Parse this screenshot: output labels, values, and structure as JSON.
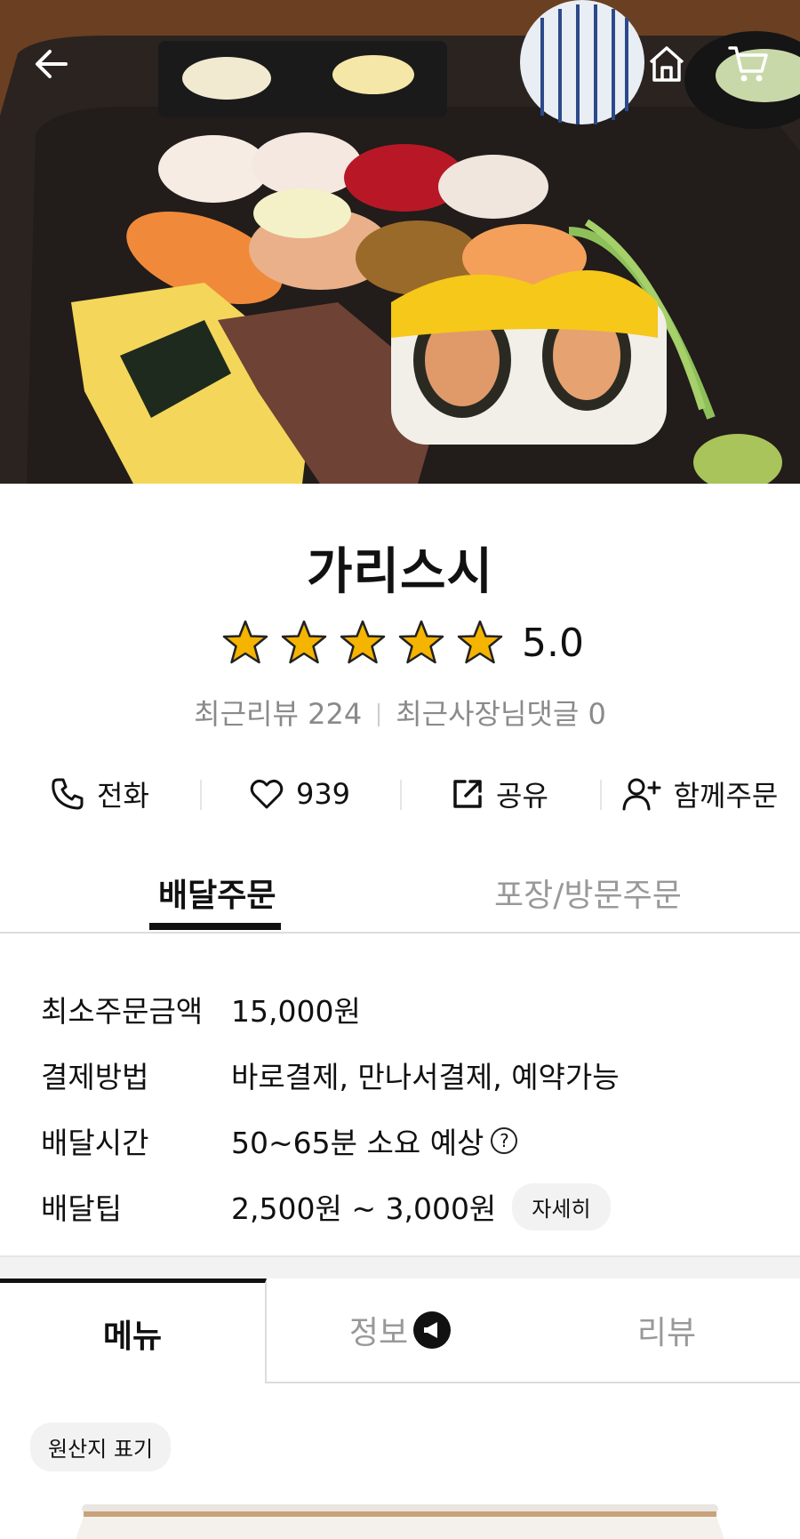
{
  "hero": {
    "back_icon": "arrow-left-icon",
    "home_icon": "home-icon",
    "cart_icon": "cart-icon"
  },
  "store": {
    "name": "가리스시",
    "rating": "5.0",
    "stars": 5,
    "recent_reviews": "최근리뷰 224",
    "owner_replies": "최근사장님댓글 0"
  },
  "actions": {
    "call": "전화",
    "likes": "939",
    "share": "공유",
    "group_order": "함께주문"
  },
  "order_tabs": {
    "delivery": "배달주문",
    "pickup": "포장/방문주문"
  },
  "details": {
    "min_order_label": "최소주문금액",
    "min_order_value": "15,000원",
    "payment_label": "결제방법",
    "payment_value": "바로결제, 만나서결제, 예약가능",
    "time_label": "배달시간",
    "time_value": "50~65분 소요 예상",
    "tip_label": "배달팁",
    "tip_value": "2,500원 ~ 3,000원",
    "tip_detail": "자세히"
  },
  "menu_tabs": {
    "menu": "메뉴",
    "info": "정보",
    "review": "리뷰"
  },
  "origin_label": "원산지 표기",
  "colors": {
    "star": "#f5b400",
    "text": "#111111",
    "muted": "#8a8a8a"
  }
}
